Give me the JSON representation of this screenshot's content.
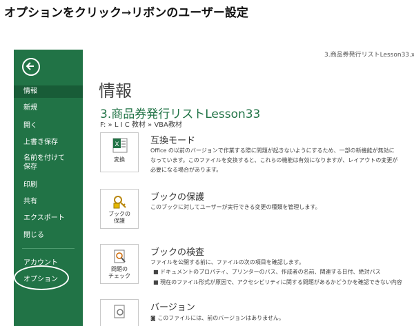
{
  "caption": "オプションをクリック→リボンのユーザー設定",
  "window_title": "3.商品券発行リストLesson33.x",
  "sidebar": {
    "items": [
      {
        "label": "情報"
      },
      {
        "label": "新規"
      },
      {
        "label": "開く"
      },
      {
        "label": "上書き保存"
      },
      {
        "label": "名前を付けて"
      },
      {
        "label": "保存"
      },
      {
        "label": "印刷"
      },
      {
        "label": "共有"
      },
      {
        "label": "エクスポート"
      },
      {
        "label": "閉じる"
      },
      {
        "label": "アカウント"
      },
      {
        "label": "オプション"
      }
    ]
  },
  "main": {
    "title": "情報",
    "doc_name": "3.商品券発行リストLesson33",
    "doc_path": "F: » L I C 教材 » VBA教材",
    "sections": [
      {
        "tile_label": "変換",
        "title": "互換モード",
        "desc": "Office の以前のバージョンで作業する際に問題が起きないようにするため、一部の新機能が無効になっています。このファイルを変換すると、これらの機能は有効になりますが、レイアウトの変更が必要になる場合があります。"
      },
      {
        "tile_label_1": "ブックの",
        "tile_label_2": "保護",
        "title": "ブックの保護",
        "desc": "このブックに対してユーザーが実行できる変更の種類を管理します。"
      },
      {
        "tile_label_1": "問題の",
        "tile_label_2": "チェック",
        "title": "ブックの検査",
        "desc": "ファイルを公開する前に、ファイルの次の項目を確認します。",
        "bullets": [
          "ドキュメントのプロパティ、プリンターのパス、作成者の名前、関連する日付、絶対パス",
          "現在のファイル形式が原因で、アクセシビリティに関する問題があるかどうかを確認できない内容"
        ]
      },
      {
        "title": "バージョン",
        "desc": "このファイルには、前のバージョンはありません。"
      }
    ]
  }
}
